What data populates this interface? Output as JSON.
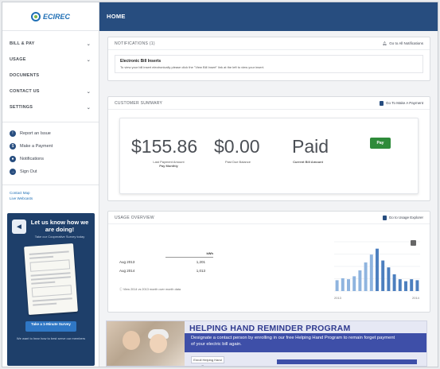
{
  "brand": {
    "logo_text": "ECIREC",
    "logo_sub": ""
  },
  "sidebar": {
    "nav": [
      {
        "label": "BILL & PAY",
        "expandable": true
      },
      {
        "label": "USAGE",
        "expandable": true
      },
      {
        "label": "DOCUMENTS",
        "expandable": false
      },
      {
        "label": "CONTACT US",
        "expandable": true
      },
      {
        "label": "SETTINGS",
        "expandable": true
      }
    ],
    "quick": [
      {
        "label": "Report an Issue",
        "icon": "alert-icon"
      },
      {
        "label": "Make a Payment",
        "icon": "dollar-icon"
      },
      {
        "label": "Notifications",
        "icon": "bell-icon"
      },
      {
        "label": "Sign Out",
        "icon": "signout-icon"
      }
    ],
    "links": [
      "Contact Map",
      "Live Webcasts"
    ],
    "promo": {
      "title": "Let us know how we are doing!",
      "subtitle": "Take our Cooperative Survey today",
      "button": "Take a 1-Minute Survey",
      "footer": "We want to hear how to best serve our members"
    }
  },
  "topbar": {
    "title": "HOME"
  },
  "notifications": {
    "title": "NOTIFICATIONS (1)",
    "action": "Go to All Notifications",
    "item_title": "Electronic Bill Inserts",
    "item_text": "To view your bill insert electronically please click the \"View Bill Insert\" link at the left to view your insert."
  },
  "customer_summary": {
    "title": "CUSTOMER SUMMARY",
    "action": "Go To Make A Payment",
    "last_payment": "$155.86",
    "last_payment_label": "Last Payment Amount",
    "last_payment_sub": "Pay Monthly",
    "past_due": "$0.00",
    "past_due_label": "Past Due Balance",
    "status": "Paid",
    "status_label": "Current Bill Amount",
    "pay_button": "Pay"
  },
  "usage": {
    "title": "USAGE OVERVIEW",
    "action": "Go to Usage Explorer",
    "table_header": "kWh",
    "rows": [
      {
        "period": "Aug 2013",
        "value": "1,201"
      },
      {
        "period": "Aug 2014",
        "value": "1,013"
      }
    ],
    "note": "View 2014 vs 2013 month over month data",
    "bars": [
      0.22,
      0.26,
      0.24,
      0.3,
      0.42,
      0.58,
      0.74,
      0.86,
      0.62,
      0.48,
      0.34,
      0.24,
      0.2,
      0.24,
      0.22
    ],
    "x_start": "2013",
    "x_end": "2014"
  },
  "helping_hand": {
    "title": "HELPING HAND REMINDER PROGRAM",
    "text": "Designate a contact person by enrolling in our free Helping Hand Program to remain forget payment of your electric bill again.",
    "button": "Enroll Helping Hand Program"
  }
}
